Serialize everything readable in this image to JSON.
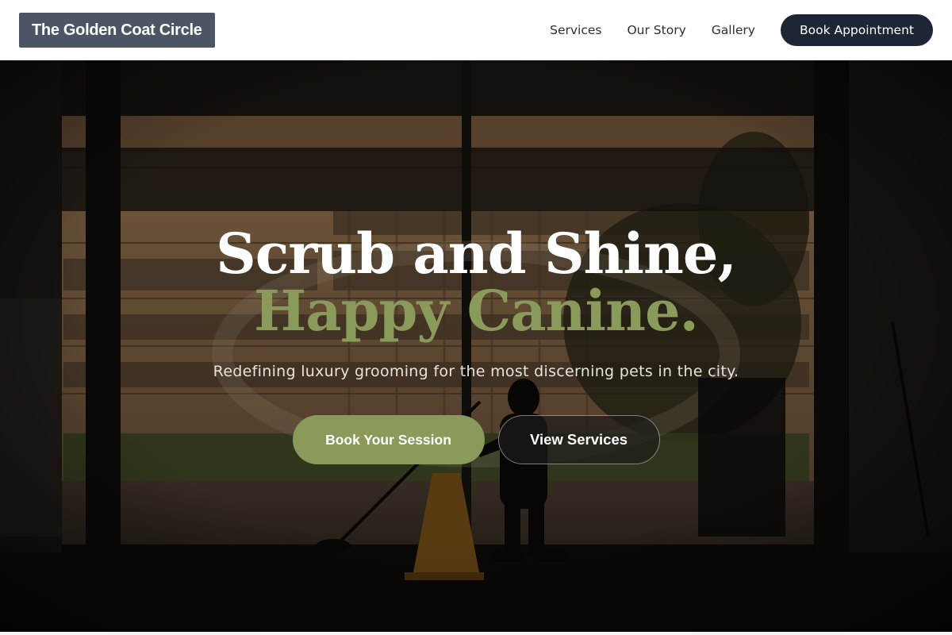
{
  "nav": {
    "brand": "The Golden Coat Circle",
    "links": [
      "Services",
      "Our Story",
      "Gallery"
    ],
    "cta": "Book Appointment"
  },
  "hero": {
    "headline_line1": "Scrub and Shine,",
    "headline_line2": "Happy Canine.",
    "subtitle": "Redefining luxury grooming for the most discerning pets in the city.",
    "primary_button": "Book Your Session",
    "secondary_button": "View Services",
    "background_image": "night-storefront-silhouette-mopping-floor-photo"
  },
  "colors": {
    "nav_bg": "#ffffff",
    "brand_bg": "#4b5563",
    "cta_bg": "#1e2535",
    "accent": "#8a9a5b",
    "text_light": "#ffffff"
  }
}
